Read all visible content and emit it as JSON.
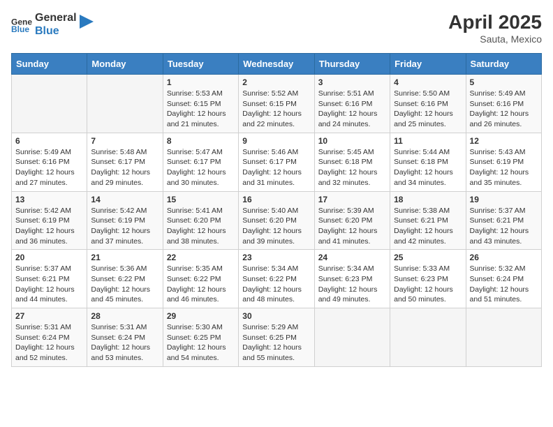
{
  "header": {
    "logo_general": "General",
    "logo_blue": "Blue",
    "month_title": "April 2025",
    "subtitle": "Sauta, Mexico"
  },
  "weekdays": [
    "Sunday",
    "Monday",
    "Tuesday",
    "Wednesday",
    "Thursday",
    "Friday",
    "Saturday"
  ],
  "weeks": [
    [
      {
        "day": "",
        "info": ""
      },
      {
        "day": "",
        "info": ""
      },
      {
        "day": "1",
        "info": "Sunrise: 5:53 AM\nSunset: 6:15 PM\nDaylight: 12 hours and 21 minutes."
      },
      {
        "day": "2",
        "info": "Sunrise: 5:52 AM\nSunset: 6:15 PM\nDaylight: 12 hours and 22 minutes."
      },
      {
        "day": "3",
        "info": "Sunrise: 5:51 AM\nSunset: 6:16 PM\nDaylight: 12 hours and 24 minutes."
      },
      {
        "day": "4",
        "info": "Sunrise: 5:50 AM\nSunset: 6:16 PM\nDaylight: 12 hours and 25 minutes."
      },
      {
        "day": "5",
        "info": "Sunrise: 5:49 AM\nSunset: 6:16 PM\nDaylight: 12 hours and 26 minutes."
      }
    ],
    [
      {
        "day": "6",
        "info": "Sunrise: 5:49 AM\nSunset: 6:16 PM\nDaylight: 12 hours and 27 minutes."
      },
      {
        "day": "7",
        "info": "Sunrise: 5:48 AM\nSunset: 6:17 PM\nDaylight: 12 hours and 29 minutes."
      },
      {
        "day": "8",
        "info": "Sunrise: 5:47 AM\nSunset: 6:17 PM\nDaylight: 12 hours and 30 minutes."
      },
      {
        "day": "9",
        "info": "Sunrise: 5:46 AM\nSunset: 6:17 PM\nDaylight: 12 hours and 31 minutes."
      },
      {
        "day": "10",
        "info": "Sunrise: 5:45 AM\nSunset: 6:18 PM\nDaylight: 12 hours and 32 minutes."
      },
      {
        "day": "11",
        "info": "Sunrise: 5:44 AM\nSunset: 6:18 PM\nDaylight: 12 hours and 34 minutes."
      },
      {
        "day": "12",
        "info": "Sunrise: 5:43 AM\nSunset: 6:19 PM\nDaylight: 12 hours and 35 minutes."
      }
    ],
    [
      {
        "day": "13",
        "info": "Sunrise: 5:42 AM\nSunset: 6:19 PM\nDaylight: 12 hours and 36 minutes."
      },
      {
        "day": "14",
        "info": "Sunrise: 5:42 AM\nSunset: 6:19 PM\nDaylight: 12 hours and 37 minutes."
      },
      {
        "day": "15",
        "info": "Sunrise: 5:41 AM\nSunset: 6:20 PM\nDaylight: 12 hours and 38 minutes."
      },
      {
        "day": "16",
        "info": "Sunrise: 5:40 AM\nSunset: 6:20 PM\nDaylight: 12 hours and 39 minutes."
      },
      {
        "day": "17",
        "info": "Sunrise: 5:39 AM\nSunset: 6:20 PM\nDaylight: 12 hours and 41 minutes."
      },
      {
        "day": "18",
        "info": "Sunrise: 5:38 AM\nSunset: 6:21 PM\nDaylight: 12 hours and 42 minutes."
      },
      {
        "day": "19",
        "info": "Sunrise: 5:37 AM\nSunset: 6:21 PM\nDaylight: 12 hours and 43 minutes."
      }
    ],
    [
      {
        "day": "20",
        "info": "Sunrise: 5:37 AM\nSunset: 6:21 PM\nDaylight: 12 hours and 44 minutes."
      },
      {
        "day": "21",
        "info": "Sunrise: 5:36 AM\nSunset: 6:22 PM\nDaylight: 12 hours and 45 minutes."
      },
      {
        "day": "22",
        "info": "Sunrise: 5:35 AM\nSunset: 6:22 PM\nDaylight: 12 hours and 46 minutes."
      },
      {
        "day": "23",
        "info": "Sunrise: 5:34 AM\nSunset: 6:22 PM\nDaylight: 12 hours and 48 minutes."
      },
      {
        "day": "24",
        "info": "Sunrise: 5:34 AM\nSunset: 6:23 PM\nDaylight: 12 hours and 49 minutes."
      },
      {
        "day": "25",
        "info": "Sunrise: 5:33 AM\nSunset: 6:23 PM\nDaylight: 12 hours and 50 minutes."
      },
      {
        "day": "26",
        "info": "Sunrise: 5:32 AM\nSunset: 6:24 PM\nDaylight: 12 hours and 51 minutes."
      }
    ],
    [
      {
        "day": "27",
        "info": "Sunrise: 5:31 AM\nSunset: 6:24 PM\nDaylight: 12 hours and 52 minutes."
      },
      {
        "day": "28",
        "info": "Sunrise: 5:31 AM\nSunset: 6:24 PM\nDaylight: 12 hours and 53 minutes."
      },
      {
        "day": "29",
        "info": "Sunrise: 5:30 AM\nSunset: 6:25 PM\nDaylight: 12 hours and 54 minutes."
      },
      {
        "day": "30",
        "info": "Sunrise: 5:29 AM\nSunset: 6:25 PM\nDaylight: 12 hours and 55 minutes."
      },
      {
        "day": "",
        "info": ""
      },
      {
        "day": "",
        "info": ""
      },
      {
        "day": "",
        "info": ""
      }
    ]
  ]
}
